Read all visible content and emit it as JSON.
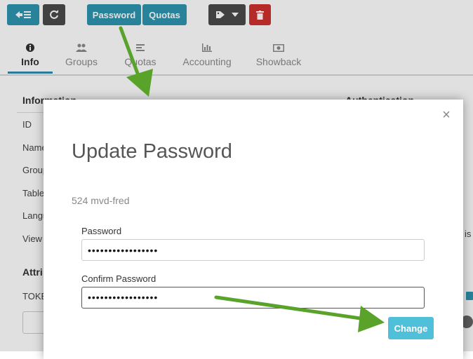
{
  "toolbar": {
    "password_label": "Password",
    "quotas_label": "Quotas"
  },
  "tabs": [
    {
      "label": "Info",
      "icon": "info-icon"
    },
    {
      "label": "Groups",
      "icon": "users-icon"
    },
    {
      "label": "Quotas",
      "icon": "align-icon"
    },
    {
      "label": "Accounting",
      "icon": "chart-icon"
    },
    {
      "label": "Showback",
      "icon": "money-icon"
    }
  ],
  "background": {
    "info_heading": "Information",
    "auth_heading": "Authentication",
    "rows": [
      "ID",
      "Name",
      "Group",
      "Table",
      "Langu",
      "View"
    ],
    "attributes_heading": "Attri",
    "token_label": "TOKE",
    "side_text": "is"
  },
  "modal": {
    "title": "Update Password",
    "subtitle": "524 mvd-fred",
    "password_label": "Password",
    "password_value": "•••••••••••••••••",
    "confirm_label": "Confirm Password",
    "confirm_value": "•••••••••••••••••",
    "change_label": "Change",
    "close_glyph": "×"
  },
  "colors": {
    "accent": "#2e96b0",
    "change": "#4fbfda",
    "danger": "#d0312d",
    "annotation_arrow": "#5aa32a"
  }
}
